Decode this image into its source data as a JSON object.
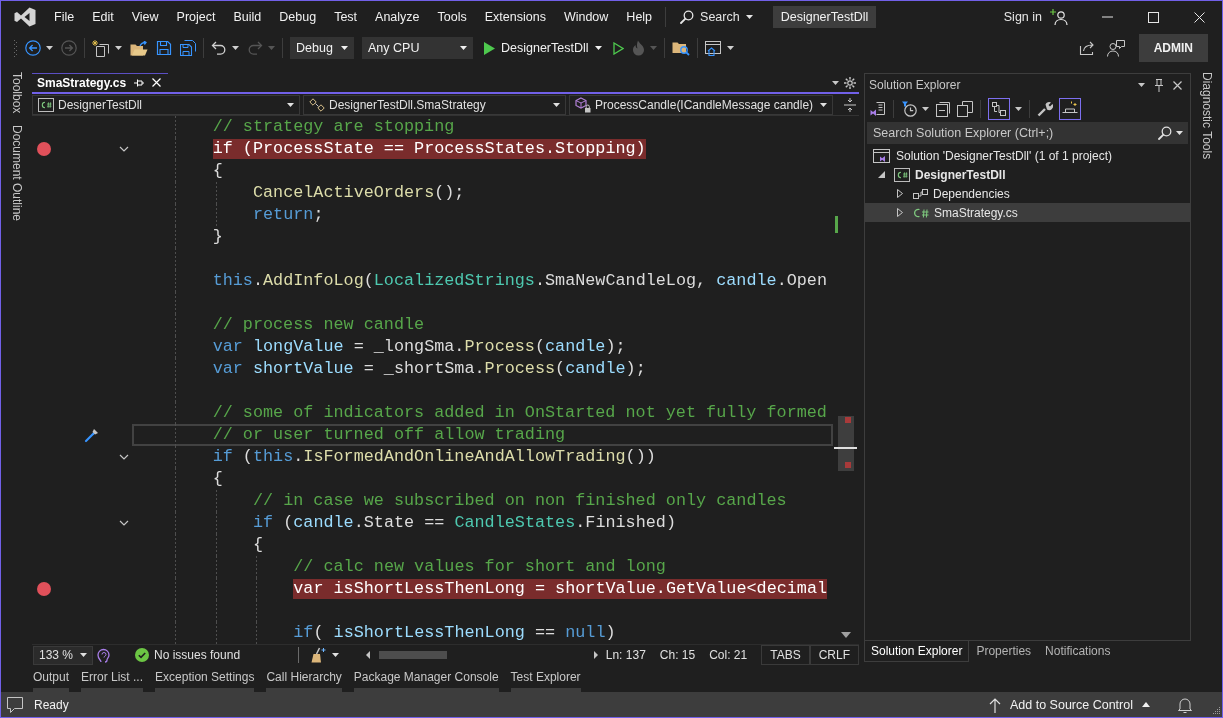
{
  "title_bar": {
    "menu": [
      {
        "label": "File"
      },
      {
        "label": "Edit"
      },
      {
        "label": "View"
      },
      {
        "label": "Project"
      },
      {
        "label": "Build"
      },
      {
        "label": "Debug"
      },
      {
        "label": "Test"
      },
      {
        "label": "Analyze"
      },
      {
        "label": "Tools"
      },
      {
        "label": "Extensions"
      },
      {
        "label": "Window"
      },
      {
        "label": "Help"
      }
    ],
    "search": "Search",
    "solution_name": "DesignerTestDll",
    "sign_in": "Sign in"
  },
  "toolbar": {
    "groups": [
      [
        {
          "kind": "back",
          "disabled": false,
          "menu": true
        },
        {
          "kind": "forward",
          "disabled": true,
          "menu": false
        }
      ],
      [
        {
          "kind": "new-item",
          "disabled": false,
          "menu": true
        },
        {
          "kind": "open",
          "disabled": false,
          "menu": false
        },
        {
          "kind": "save",
          "disabled": false,
          "menu": false
        },
        {
          "kind": "save-all",
          "disabled": false,
          "menu": false
        }
      ],
      [
        {
          "kind": "undo",
          "disabled": false,
          "menu": true
        },
        {
          "kind": "redo",
          "disabled": true,
          "menu": true
        }
      ],
      [
        {
          "kind": "dropdown",
          "value": "Debug"
        },
        {
          "kind": "dropdown",
          "value": "Any CPU"
        },
        {
          "kind": "start",
          "label": "DesignerTestDll"
        },
        {
          "kind": "start-without-debugging",
          "disabled": false,
          "menu": false
        },
        {
          "kind": "hot-reload",
          "disabled": true,
          "menu": true
        }
      ],
      [
        {
          "kind": "find-in-files",
          "disabled": false,
          "menu": false
        }
      ],
      [
        {
          "kind": "layout",
          "disabled": false,
          "menu": true
        }
      ]
    ],
    "user": "ADMIN"
  },
  "left_strip": [
    "Toolbox",
    "Document Outline"
  ],
  "editor": {
    "tabs": [
      {
        "label": "SmaStrategy.cs",
        "selected": true
      }
    ],
    "navigation": {
      "project": "DesignerTestDll",
      "type": "DesignerTestDll.SmaStrategy",
      "member": "ProcessCandle(ICandleMessage candle)"
    },
    "lines": [
      {
        "kind": "code",
        "tokens": [
          {
            "kind": "comment",
            "text": "// strategy are stopping"
          }
        ],
        "breakpoint": false,
        "fold_marker": false,
        "current": false
      },
      {
        "kind": "code",
        "tokens": [
          {
            "kind": "keyword",
            "text": "if"
          },
          {
            "kind": "plain",
            "text": " (ProcessState == "
          },
          {
            "kind": "type",
            "text": "ProcessStates"
          },
          {
            "kind": "plain",
            "text": ".Stopping)"
          }
        ],
        "breakpoint": true,
        "fold_marker": true,
        "current": false
      },
      {
        "kind": "code",
        "tokens": [
          {
            "kind": "plain",
            "text": "{"
          }
        ],
        "breakpoint": false,
        "fold_marker": false,
        "current": false,
        "children": [
          {
            "kind": "code",
            "tokens": [
              {
                "kind": "method",
                "text": "CancelActiveOrders"
              },
              {
                "kind": "plain",
                "text": "();"
              }
            ],
            "breakpoint": false,
            "fold_marker": false,
            "current": false
          },
          {
            "kind": "code",
            "tokens": [
              {
                "kind": "keyword",
                "text": "return"
              },
              {
                "kind": "plain",
                "text": ";"
              }
            ],
            "breakpoint": false,
            "fold_marker": false,
            "current": false
          }
        ]
      },
      {
        "kind": "code",
        "tokens": [
          {
            "kind": "plain",
            "text": "}"
          }
        ],
        "breakpoint": false,
        "fold_marker": false,
        "current": false
      },
      {
        "kind": "blank"
      },
      {
        "kind": "code",
        "tokens": [
          {
            "kind": "keyword",
            "text": "this"
          },
          {
            "kind": "plain",
            "text": "."
          },
          {
            "kind": "method",
            "text": "AddInfoLog"
          },
          {
            "kind": "plain",
            "text": "("
          },
          {
            "kind": "type",
            "text": "LocalizedStrings"
          },
          {
            "kind": "plain",
            "text": ".SmaNewCandleLog, "
          },
          {
            "kind": "variable",
            "text": "candle"
          },
          {
            "kind": "plain",
            "text": ".Open"
          }
        ],
        "breakpoint": false,
        "fold_marker": false,
        "current": false
      },
      {
        "kind": "blank"
      },
      {
        "kind": "code",
        "tokens": [
          {
            "kind": "comment",
            "text": "// process new candle"
          }
        ],
        "breakpoint": false,
        "fold_marker": false,
        "current": false
      },
      {
        "kind": "code",
        "tokens": [
          {
            "kind": "keyword",
            "text": "var "
          },
          {
            "kind": "variable",
            "text": "longValue"
          },
          {
            "kind": "plain",
            "text": " = _longSma."
          },
          {
            "kind": "method",
            "text": "Process"
          },
          {
            "kind": "plain",
            "text": "("
          },
          {
            "kind": "variable",
            "text": "candle"
          },
          {
            "kind": "plain",
            "text": ");"
          }
        ],
        "breakpoint": false,
        "fold_marker": false,
        "current": false
      },
      {
        "kind": "code",
        "tokens": [
          {
            "kind": "keyword",
            "text": "var "
          },
          {
            "kind": "variable",
            "text": "shortValue"
          },
          {
            "kind": "plain",
            "text": " = _shortSma."
          },
          {
            "kind": "method",
            "text": "Process"
          },
          {
            "kind": "plain",
            "text": "("
          },
          {
            "kind": "variable",
            "text": "candle"
          },
          {
            "kind": "plain",
            "text": ");"
          }
        ],
        "breakpoint": false,
        "fold_marker": false,
        "current": false
      },
      {
        "kind": "blank"
      },
      {
        "kind": "code",
        "tokens": [
          {
            "kind": "comment",
            "text": "// some of indicators added in OnStarted not yet fully formed"
          }
        ],
        "breakpoint": false,
        "fold_marker": false,
        "current": false
      },
      {
        "kind": "code",
        "tokens": [
          {
            "kind": "comment",
            "text": "// or user turned off allow trading"
          }
        ],
        "breakpoint": false,
        "fold_marker": false,
        "current": true
      },
      {
        "kind": "code",
        "tokens": [
          {
            "kind": "keyword",
            "text": "if"
          },
          {
            "kind": "plain",
            "text": " ("
          },
          {
            "kind": "keyword",
            "text": "this"
          },
          {
            "kind": "plain",
            "text": "."
          },
          {
            "kind": "method",
            "text": "IsFormedAndOnlineAndAllowTrading"
          },
          {
            "kind": "plain",
            "text": "())"
          }
        ],
        "breakpoint": false,
        "fold_marker": true,
        "current": false
      },
      {
        "kind": "code",
        "tokens": [
          {
            "kind": "plain",
            "text": "{"
          }
        ],
        "breakpoint": false,
        "fold_marker": false,
        "current": false,
        "children": [
          {
            "kind": "code",
            "tokens": [
              {
                "kind": "comment",
                "text": "// in case we subscribed on non finished only candles"
              }
            ],
            "breakpoint": false,
            "fold_marker": false,
            "current": false
          },
          {
            "kind": "code",
            "tokens": [
              {
                "kind": "keyword",
                "text": "if"
              },
              {
                "kind": "plain",
                "text": " ("
              },
              {
                "kind": "variable",
                "text": "candle"
              },
              {
                "kind": "plain",
                "text": ".State == "
              },
              {
                "kind": "type",
                "text": "CandleStates"
              },
              {
                "kind": "plain",
                "text": ".Finished)"
              }
            ],
            "breakpoint": false,
            "fold_marker": true,
            "current": false
          },
          {
            "kind": "code",
            "tokens": [
              {
                "kind": "plain",
                "text": "{"
              }
            ],
            "breakpoint": false,
            "fold_marker": false,
            "current": false,
            "children": [
              {
                "kind": "code",
                "tokens": [
                  {
                    "kind": "comment",
                    "text": "// calc new values for short and long"
                  }
                ],
                "breakpoint": false,
                "fold_marker": false,
                "current": false
              },
              {
                "kind": "code",
                "tokens": [
                  {
                    "kind": "keyword",
                    "text": "var "
                  },
                  {
                    "kind": "variable",
                    "text": "isShortLessThenLong"
                  },
                  {
                    "kind": "plain",
                    "text": " = "
                  },
                  {
                    "kind": "variable",
                    "text": "shortValue"
                  },
                  {
                    "kind": "plain",
                    "text": "."
                  },
                  {
                    "kind": "method",
                    "text": "GetValue"
                  },
                  {
                    "kind": "plain",
                    "text": "<"
                  },
                  {
                    "kind": "keyword",
                    "text": "decimal"
                  }
                ],
                "breakpoint": true,
                "fold_marker": false,
                "current": false
              },
              {
                "kind": "blank"
              },
              {
                "kind": "code",
                "tokens": [
                  {
                    "kind": "keyword",
                    "text": "if"
                  },
                  {
                    "kind": "plain",
                    "text": "( "
                  },
                  {
                    "kind": "variable",
                    "text": "isShortLessThenLong"
                  },
                  {
                    "kind": "plain",
                    "text": " == "
                  },
                  {
                    "kind": "keyword",
                    "text": "null"
                  },
                  {
                    "kind": "plain",
                    "text": ")"
                  }
                ],
                "breakpoint": false,
                "fold_marker": false,
                "current": false
              }
            ]
          }
        ]
      }
    ],
    "zoom": "133 %",
    "issues": "No issues found",
    "position": [
      "Ln: 137",
      "Ch: 15",
      "Col: 21"
    ],
    "indentation": "TABS",
    "line_endings": "CRLF"
  },
  "solution_explorer": {
    "title": "Solution Explorer",
    "toolbar": [
      [
        {
          "kind": "switch-views",
          "on": false,
          "menu": false
        }
      ],
      [
        {
          "kind": "pending-changes",
          "on": false,
          "menu": true
        },
        {
          "kind": "collapse-all",
          "on": false,
          "menu": false
        },
        {
          "kind": "show-all-files",
          "on": false,
          "menu": false
        }
      ],
      [
        {
          "kind": "tree-view",
          "on": true,
          "menu": true
        }
      ],
      [
        {
          "kind": "properties",
          "on": false,
          "menu": false
        },
        {
          "kind": "preview",
          "on": true,
          "menu": false
        }
      ]
    ],
    "search": {
      "placeholder": "Search Solution Explorer (Ctrl+;)"
    },
    "tree": [
      {
        "kind": "solution",
        "label": "Solution 'DesignerTestDll' (1 of 1 project)",
        "selected": false,
        "children": [
          {
            "kind": "project",
            "label": "DesignerTestDll",
            "expanded": true,
            "selected": false,
            "children": [
              {
                "kind": "dependencies",
                "label": "Dependencies",
                "expanded": false,
                "selected": false
              },
              {
                "kind": "csharp-file",
                "label": "SmaStrategy.cs",
                "expanded": false,
                "selected": true
              }
            ]
          }
        ]
      }
    ],
    "tabs": [
      {
        "label": "Solution Explorer",
        "selected": true
      },
      {
        "label": "Properties",
        "selected": false
      },
      {
        "label": "Notifications",
        "selected": false
      }
    ]
  },
  "right_strip": [
    "Diagnostic Tools"
  ],
  "tool_windows": [
    "Output",
    "Error List ...",
    "Exception Settings",
    "Call Hierarchy",
    "Package Manager Console",
    "Test Explorer"
  ],
  "status_bar": {
    "message": "Ready",
    "source_control": "Add to Source Control"
  }
}
